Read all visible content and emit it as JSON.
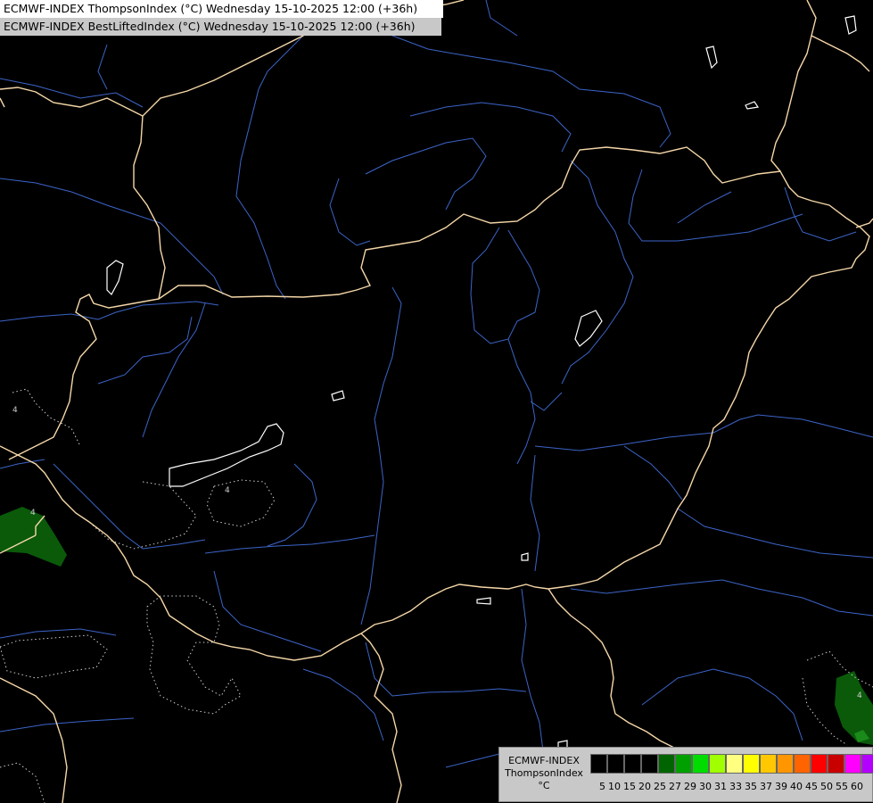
{
  "title": {
    "line1": "ECMWF-INDEX ThompsonIndex (°C) Wednesday 15-10-2025 12:00 (+36h)",
    "line2": "ECMWF-INDEX BestLiftedIndex (°C) Wednesday 15-10-2025 12:00 (+36h)"
  },
  "legend": {
    "model": "ECMWF-INDEX",
    "param": "ThompsonIndex",
    "unit": "°C",
    "colors": [
      "#000000",
      "#000000",
      "#000000",
      "#000000",
      "#006400",
      "#00a000",
      "#00dc00",
      "#a0ff00",
      "#ffff80",
      "#ffff00",
      "#ffc800",
      "#ff9600",
      "#ff6400",
      "#ff0000",
      "#c80000",
      "#ff00ff",
      "#b400ff",
      "#7800ff",
      "#0000ff"
    ],
    "labels": [
      "5",
      "10",
      "15",
      "20",
      "25",
      "27",
      "29",
      "30",
      "31",
      "33",
      "35",
      "37",
      "39",
      "40",
      "45",
      "50",
      "55",
      "60"
    ]
  },
  "style": {
    "border_color": "#f5d7a8",
    "river_color": "#3c64c8",
    "lake_color": "#ffffff",
    "contour_color": "#cccccc",
    "fill_green": "#0a5a0a"
  }
}
